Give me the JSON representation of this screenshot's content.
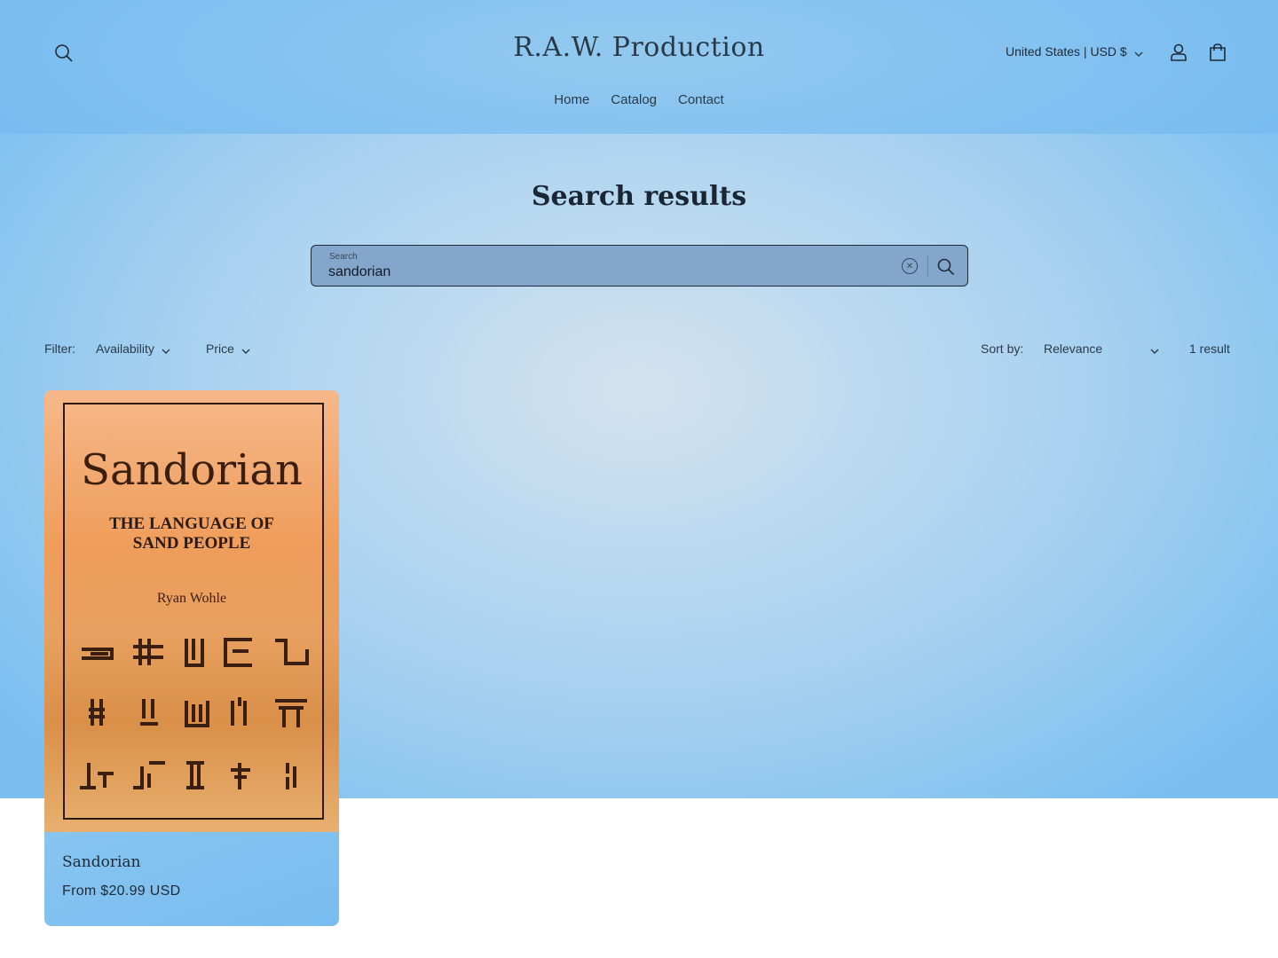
{
  "header": {
    "logo": "R.A.W. Production",
    "nav": [
      "Home",
      "Catalog",
      "Contact"
    ],
    "country_selector": "United States | USD $"
  },
  "main": {
    "title": "Search results",
    "search": {
      "label": "Search",
      "value": "sandorian"
    },
    "filters": {
      "label": "Filter:",
      "availability": "Availability",
      "price": "Price"
    },
    "sort": {
      "label": "Sort by:",
      "value": "Relevance"
    },
    "result_count": "1 result",
    "products": [
      {
        "title": "Sandorian",
        "price": "From $20.99 USD",
        "cover": {
          "title": "Sandorian",
          "subtitle_line1": "THE LANGUAGE OF",
          "subtitle_line2": "SAND PEOPLE",
          "author": "Ryan Wohle"
        }
      }
    ]
  }
}
